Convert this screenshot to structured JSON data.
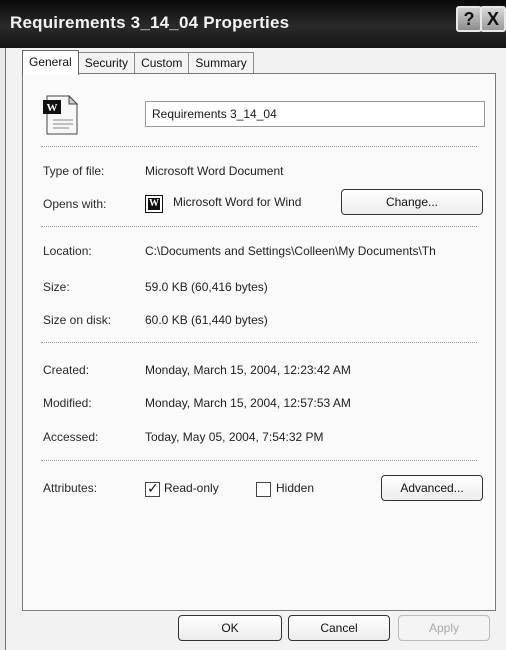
{
  "window": {
    "title": "Requirements 3_14_04 Properties",
    "help_icon": "?",
    "close_icon": "X"
  },
  "tabs": [
    "General",
    "Security",
    "Custom",
    "Summary"
  ],
  "general": {
    "icon": "word-document-icon",
    "file_name": "Requirements 3_14_04",
    "type_label": "Type of file:",
    "type_value": "Microsoft Word Document",
    "opens_label": "Opens with:",
    "opens_icon": "W",
    "opens_value": "Microsoft Word for Wind",
    "change_button": "Change...",
    "location_label": "Location:",
    "location_value": "C:\\Documents and Settings\\Colleen\\My Documents\\Th",
    "size_label": "Size:",
    "size_value": "59.0 KB (60,416 bytes)",
    "size_disk_label": "Size on disk:",
    "size_disk_value": "60.0 KB (61,440 bytes)",
    "created_label": "Created:",
    "created_value": "Monday, March 15, 2004, 12:23:42 AM",
    "modified_label": "Modified:",
    "modified_value": "Monday, March 15, 2004, 12:57:53 AM",
    "accessed_label": "Accessed:",
    "accessed_value": "Today, May 05, 2004, 7:54:32 PM",
    "attributes_label": "Attributes:",
    "readonly_label": "Read-only",
    "readonly_checked": true,
    "hidden_label": "Hidden",
    "hidden_checked": false,
    "advanced_button": "Advanced..."
  },
  "footer": {
    "ok_button": "OK",
    "cancel_button": "Cancel",
    "apply_button": "Apply"
  }
}
